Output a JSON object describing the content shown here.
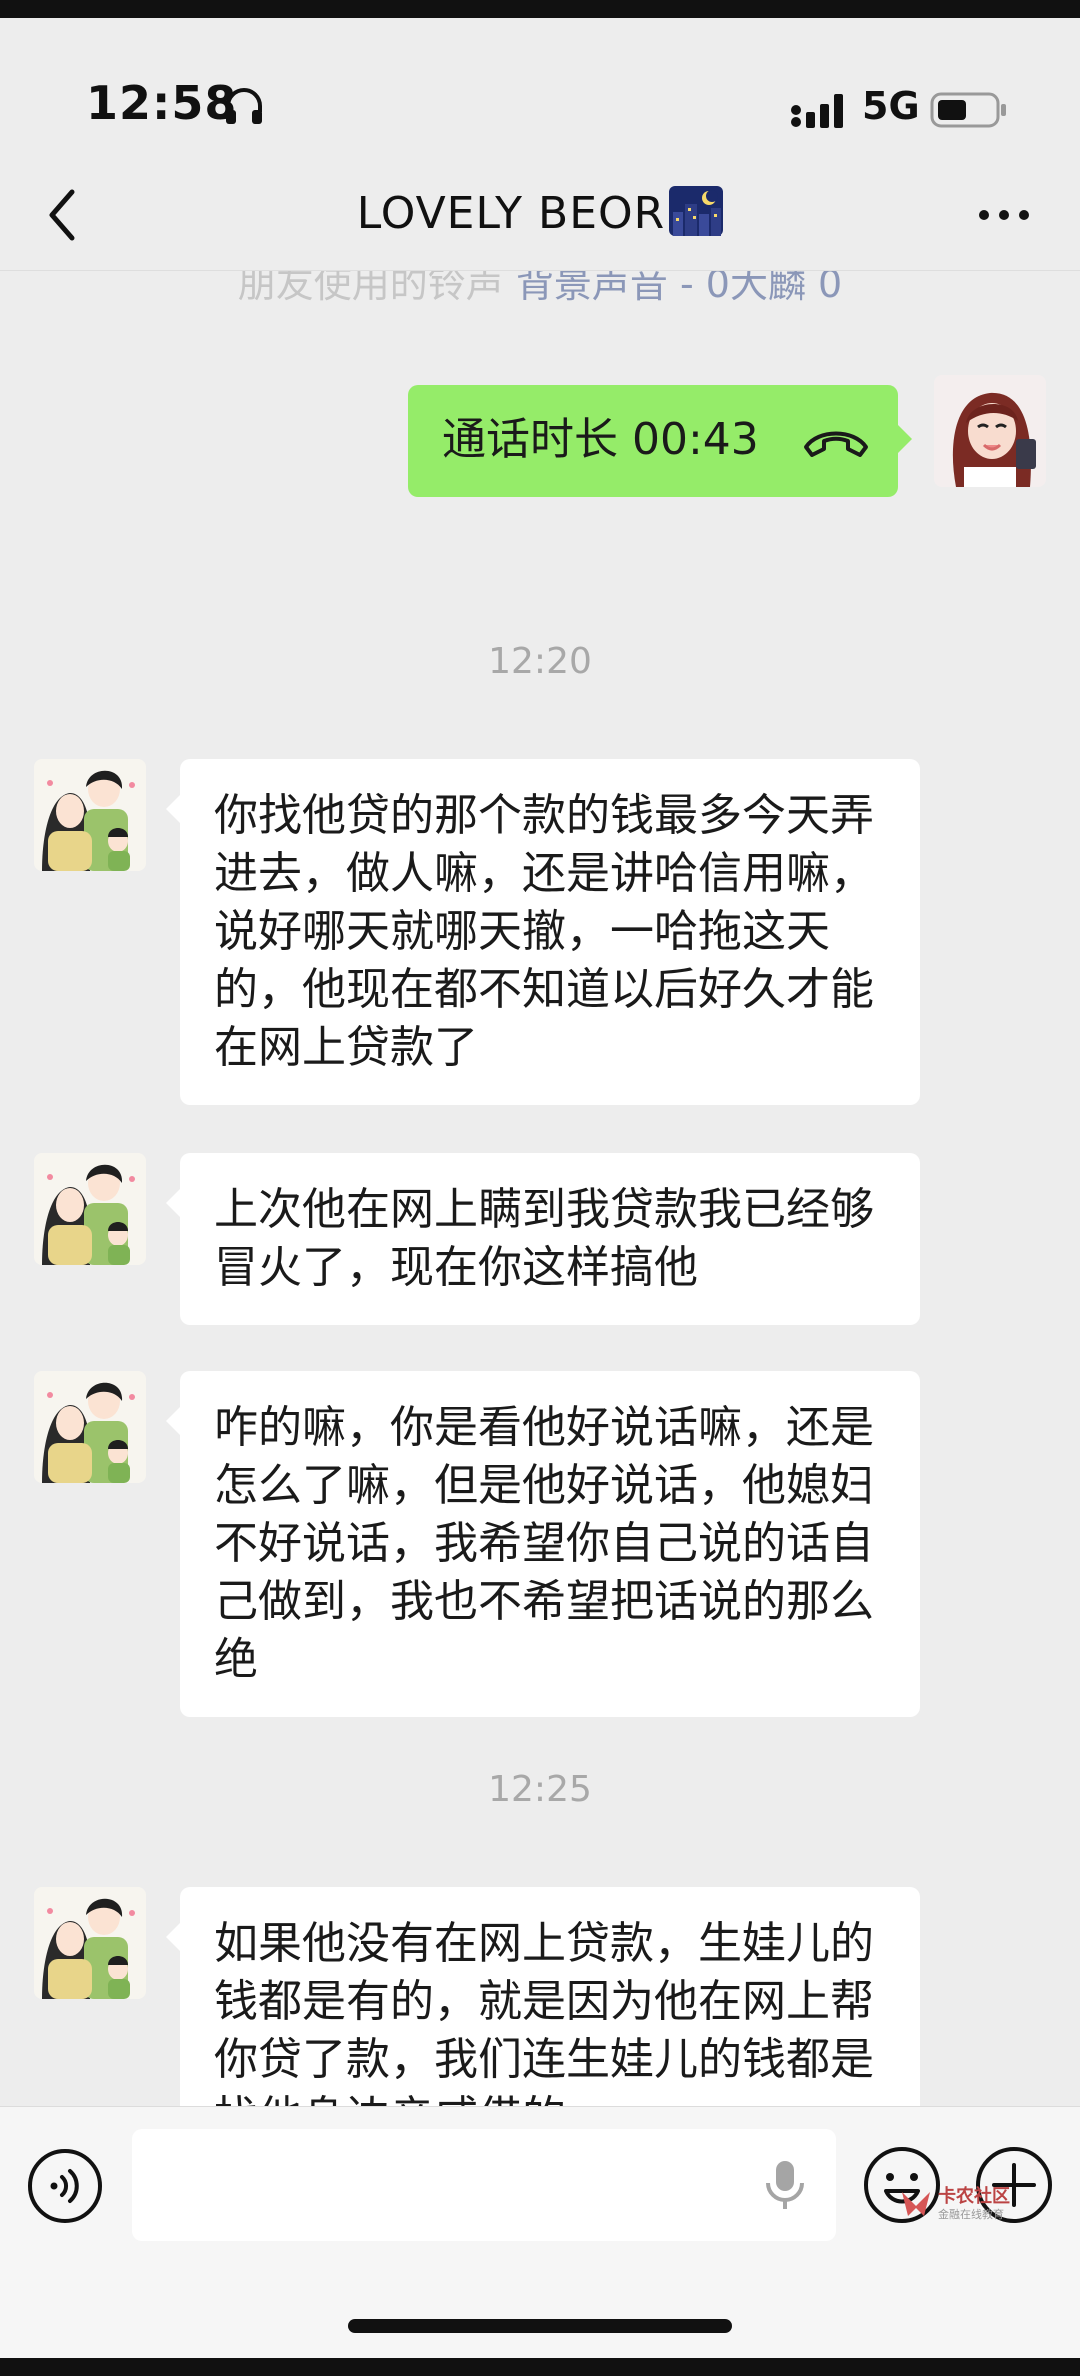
{
  "status_bar": {
    "time": "12:58",
    "network": "5G"
  },
  "nav": {
    "title": "LOVELY BEOR"
  },
  "chat": {
    "cut_text_prefix": "朋友使用的铃声 ",
    "cut_text_link": "背景声音 - 0大麟 0",
    "call_bubble": {
      "text": "通话时长 00:43"
    },
    "timestamps": [
      "12:20",
      "12:25"
    ],
    "messages": [
      {
        "text": "你找他贷的那个款的钱最多今天弄进去，做人嘛，还是讲哈信用嘛，说好哪天就哪天撤，一哈拖这天的，他现在都不知道以后好久才能在网上贷款了"
      },
      {
        "text": "上次他在网上瞒到我贷款我已经够冒火了，现在你这样搞他"
      },
      {
        "text": "咋的嘛，你是看他好说话嘛，还是怎么了嘛，但是他好说话，他媳妇不好说话，我希望你自己说的话自己做到，我也不希望把话说的那么绝"
      },
      {
        "text": "如果他没有在网上贷款，生娃儿的钱都是有的，就是因为他在网上帮你贷了款，我们连生娃儿的钱都是找他身边亲戚借的"
      }
    ]
  },
  "input_bar": {
    "placeholder": ""
  },
  "watermark": {
    "title": "卡农社区",
    "subtitle": "金融在线教育"
  },
  "colors": {
    "background": "#ededed",
    "sent_bubble": "#95ec69",
    "received_bubble": "#ffffff"
  },
  "icons": [
    "headset-icon",
    "signal-icon",
    "battery-icon",
    "back-icon",
    "night-city-icon",
    "more-icon",
    "phone-hangup-icon",
    "voice-icon",
    "mic-icon",
    "emoji-icon",
    "plus-icon"
  ]
}
